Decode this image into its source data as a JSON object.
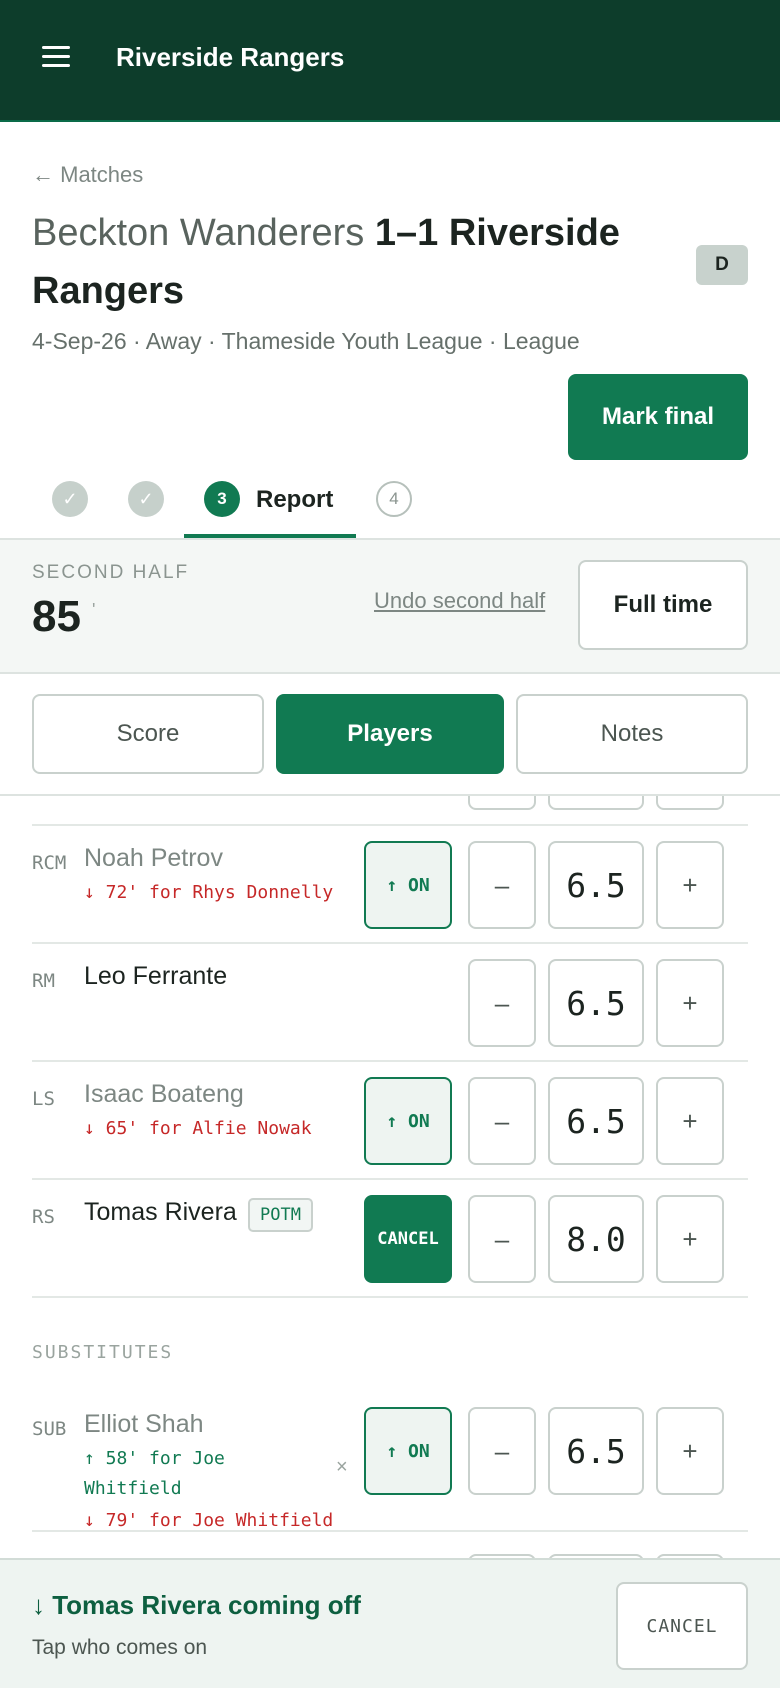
{
  "app": {
    "title": "Riverside Rangers"
  },
  "match": {
    "back_label": "← Matches",
    "home_team": "Beckton Wanderers",
    "score_and_away": "1–1 Riverside Rangers",
    "result_badge": "D",
    "meta": "4-Sep-26 · Away · Thameside Youth League · League",
    "mark_final_label": "Mark final"
  },
  "steps": {
    "done_mark": "✓",
    "current_number": "3",
    "current_label": "Report",
    "next_number": "4"
  },
  "clock": {
    "period": "SECOND HALF",
    "minute": "85",
    "minute_mark": "'",
    "undo_label": "Undo second half",
    "full_time_label": "Full time"
  },
  "tabs": [
    {
      "label": "Score",
      "active": false
    },
    {
      "label": "Players",
      "active": true
    },
    {
      "label": "Notes",
      "active": false
    }
  ],
  "players": [
    {
      "position": "RCM",
      "name": "Noah Petrov",
      "off_note": "↓ 72' for Rhys Donnelly",
      "action": "↑ ON",
      "rating": "6.5"
    },
    {
      "position": "RM",
      "name": "Leo Ferrante",
      "rating": "6.5"
    },
    {
      "position": "LS",
      "name": "Isaac Boateng",
      "off_note": "↓ 65' for Alfie Nowak",
      "action": "↑ ON",
      "rating": "6.5"
    },
    {
      "position": "RS",
      "name": "Tomas Rivera",
      "badge": "POTM",
      "action": "CANCEL",
      "rating": "8.0"
    }
  ],
  "substitutes": {
    "header": "SUBSTITUTES",
    "items": [
      {
        "position": "SUB",
        "name": "Elliot Shah",
        "on_note_1": "↑ 58' for Joe",
        "on_note_2": "Whitfield",
        "off_note": "↓ 79' for Joe Whitfield",
        "remove": "×",
        "action": "↑ ON",
        "rating": "6.5"
      }
    ]
  },
  "stepper": {
    "minus": "–",
    "plus": "+"
  },
  "sheet": {
    "title": "↓ Tomas Rivera coming off",
    "subtitle": "Tap who comes on",
    "cancel_label": "CANCEL"
  },
  "colors": {
    "brand_dark": "#0d3d2b",
    "accent": "#117a52",
    "sub_off": "#c62828"
  }
}
